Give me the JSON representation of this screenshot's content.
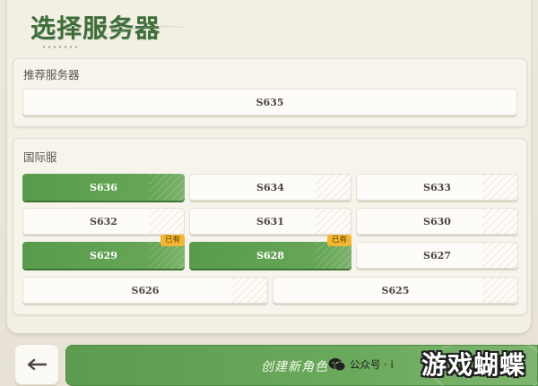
{
  "header": {
    "title": "选择服务器"
  },
  "recommended": {
    "label": "推荐服务器",
    "servers": [
      {
        "name": "S635",
        "selected": false,
        "owned": false
      }
    ]
  },
  "international": {
    "label": "国际服",
    "servers": [
      {
        "name": "S636",
        "selected": true,
        "owned": false
      },
      {
        "name": "S634",
        "selected": false,
        "owned": false
      },
      {
        "name": "S633",
        "selected": false,
        "owned": false
      },
      {
        "name": "S632",
        "selected": false,
        "owned": false
      },
      {
        "name": "S631",
        "selected": false,
        "owned": false
      },
      {
        "name": "S630",
        "selected": false,
        "owned": false
      },
      {
        "name": "S629",
        "selected": false,
        "owned": true,
        "badge": "已有"
      },
      {
        "name": "S628",
        "selected": false,
        "owned": true,
        "badge": "已有"
      },
      {
        "name": "S627",
        "selected": false,
        "owned": false
      },
      {
        "name": "S626",
        "selected": false,
        "owned": false
      },
      {
        "name": "S625",
        "selected": false,
        "owned": false
      }
    ]
  },
  "footer": {
    "back_icon": "arrow-left-icon",
    "create_label": "创建新角色"
  },
  "watermark": {
    "wechat_text": "公众号 · i",
    "site_text": "游戏蝴蝶"
  },
  "colors": {
    "accent_green": "#5f9f52",
    "badge_yellow": "#f3b632",
    "background": "#ece8dd"
  }
}
